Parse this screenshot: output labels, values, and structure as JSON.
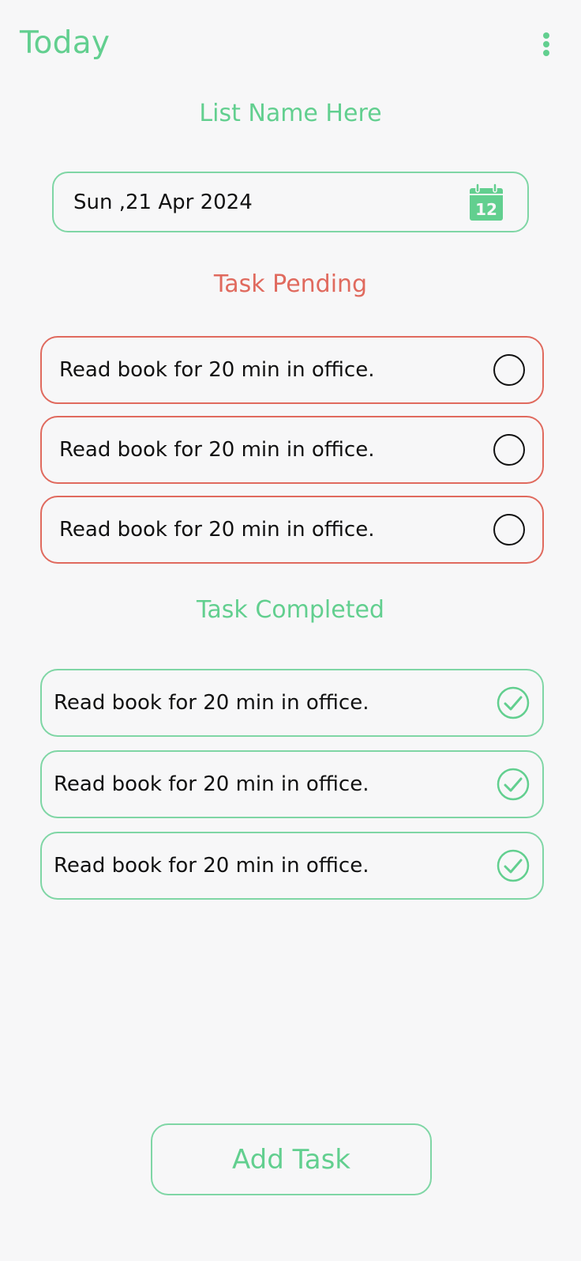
{
  "header": {
    "title": "Today",
    "menu_icon": "more-vertical-icon"
  },
  "list_name": "List Name Here",
  "date_field": {
    "value": "Sun ,21 Apr 2024",
    "icon": "calendar-icon",
    "icon_day": "12"
  },
  "pending": {
    "title": "Task Pending",
    "tasks": [
      {
        "text": "Read book for 20 min in office."
      },
      {
        "text": "Read book for 20 min in office."
      },
      {
        "text": "Read book for 20 min in office."
      }
    ]
  },
  "completed": {
    "title": "Task Completed",
    "tasks": [
      {
        "text": "Read book for 20 min in office."
      },
      {
        "text": "Read book for 20 min in office."
      },
      {
        "text": "Read book for 20 min in office."
      }
    ]
  },
  "add_button": {
    "label": "Add Task"
  },
  "colors": {
    "accent": "#62cf8f",
    "pending": "#e06a5e",
    "background": "#f7f7f8"
  }
}
